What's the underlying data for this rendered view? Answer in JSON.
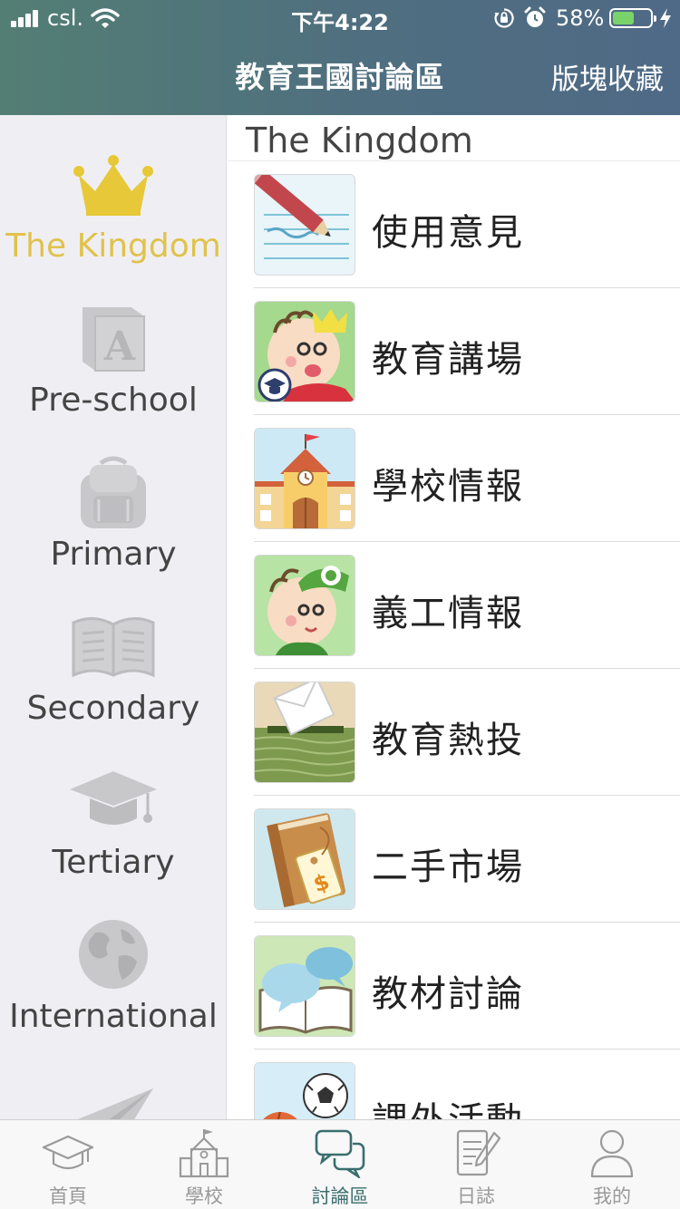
{
  "status_bar": {
    "carrier": "csl.",
    "time": "下午4:22",
    "battery_percent": "58%",
    "battery_level": 0.58,
    "icons": [
      "signal-icon",
      "wifi-icon",
      "orientation-lock-icon",
      "alarm-icon",
      "battery-icon",
      "charging-icon"
    ]
  },
  "nav": {
    "title": "教育王國討論區",
    "right_action": "版塊收藏"
  },
  "sidebar": {
    "items": [
      {
        "label": "The Kingdom",
        "icon": "crown-icon",
        "active": true
      },
      {
        "label": "Pre-school",
        "icon": "alphabet-block-icon",
        "active": false
      },
      {
        "label": "Primary",
        "icon": "backpack-icon",
        "active": false
      },
      {
        "label": "Secondary",
        "icon": "open-book-icon",
        "active": false
      },
      {
        "label": "Tertiary",
        "icon": "graduation-cap-icon",
        "active": false
      },
      {
        "label": "International",
        "icon": "globe-icon",
        "active": false
      },
      {
        "label": "",
        "icon": "paper-plane-icon",
        "active": false
      }
    ]
  },
  "content": {
    "section_title": "The Kingdom",
    "forums": [
      {
        "label": "使用意見",
        "thumb": "pencil-paper-thumb"
      },
      {
        "label": "教育講場",
        "thumb": "kid-crown-thumb"
      },
      {
        "label": "學校情報",
        "thumb": "school-building-thumb"
      },
      {
        "label": "義工情報",
        "thumb": "volunteer-kid-thumb"
      },
      {
        "label": "教育熱投",
        "thumb": "ballot-box-thumb"
      },
      {
        "label": "二手市場",
        "thumb": "book-price-tag-thumb"
      },
      {
        "label": "教材討論",
        "thumb": "book-speech-bubble-thumb"
      },
      {
        "label": "課外活動",
        "thumb": "sports-balls-thumb"
      }
    ]
  },
  "tabbar": {
    "tabs": [
      {
        "label": "首頁",
        "icon": "graduation-cap-icon",
        "active": false
      },
      {
        "label": "學校",
        "icon": "school-icon",
        "active": false
      },
      {
        "label": "討論區",
        "icon": "chat-bubbles-icon",
        "active": true
      },
      {
        "label": "日誌",
        "icon": "notepad-pencil-icon",
        "active": false
      },
      {
        "label": "我的",
        "icon": "user-icon",
        "active": false
      }
    ]
  },
  "colors": {
    "header_start": "#537e74",
    "header_end": "#4f6a86",
    "active_gold": "#e0c24c",
    "active_tab": "#3b6e6e",
    "inactive_icon": "#c6c6c9"
  }
}
